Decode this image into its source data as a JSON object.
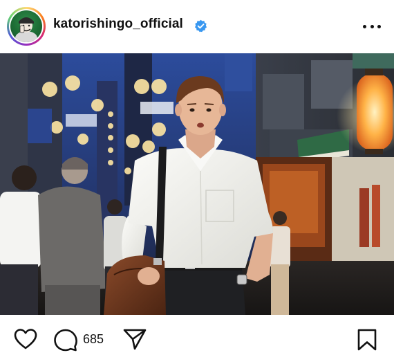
{
  "post": {
    "username": "katorishingo_official",
    "verified": true,
    "comment_count": "685"
  },
  "icons": {
    "verified": "verified-badge-icon",
    "more": "more-options-icon",
    "like": "heart-icon",
    "comment": "comment-bubble-icon",
    "share": "paper-plane-icon",
    "save": "bookmark-icon"
  },
  "colors": {
    "verified_blue": "#3897f0",
    "text": "#111111"
  }
}
